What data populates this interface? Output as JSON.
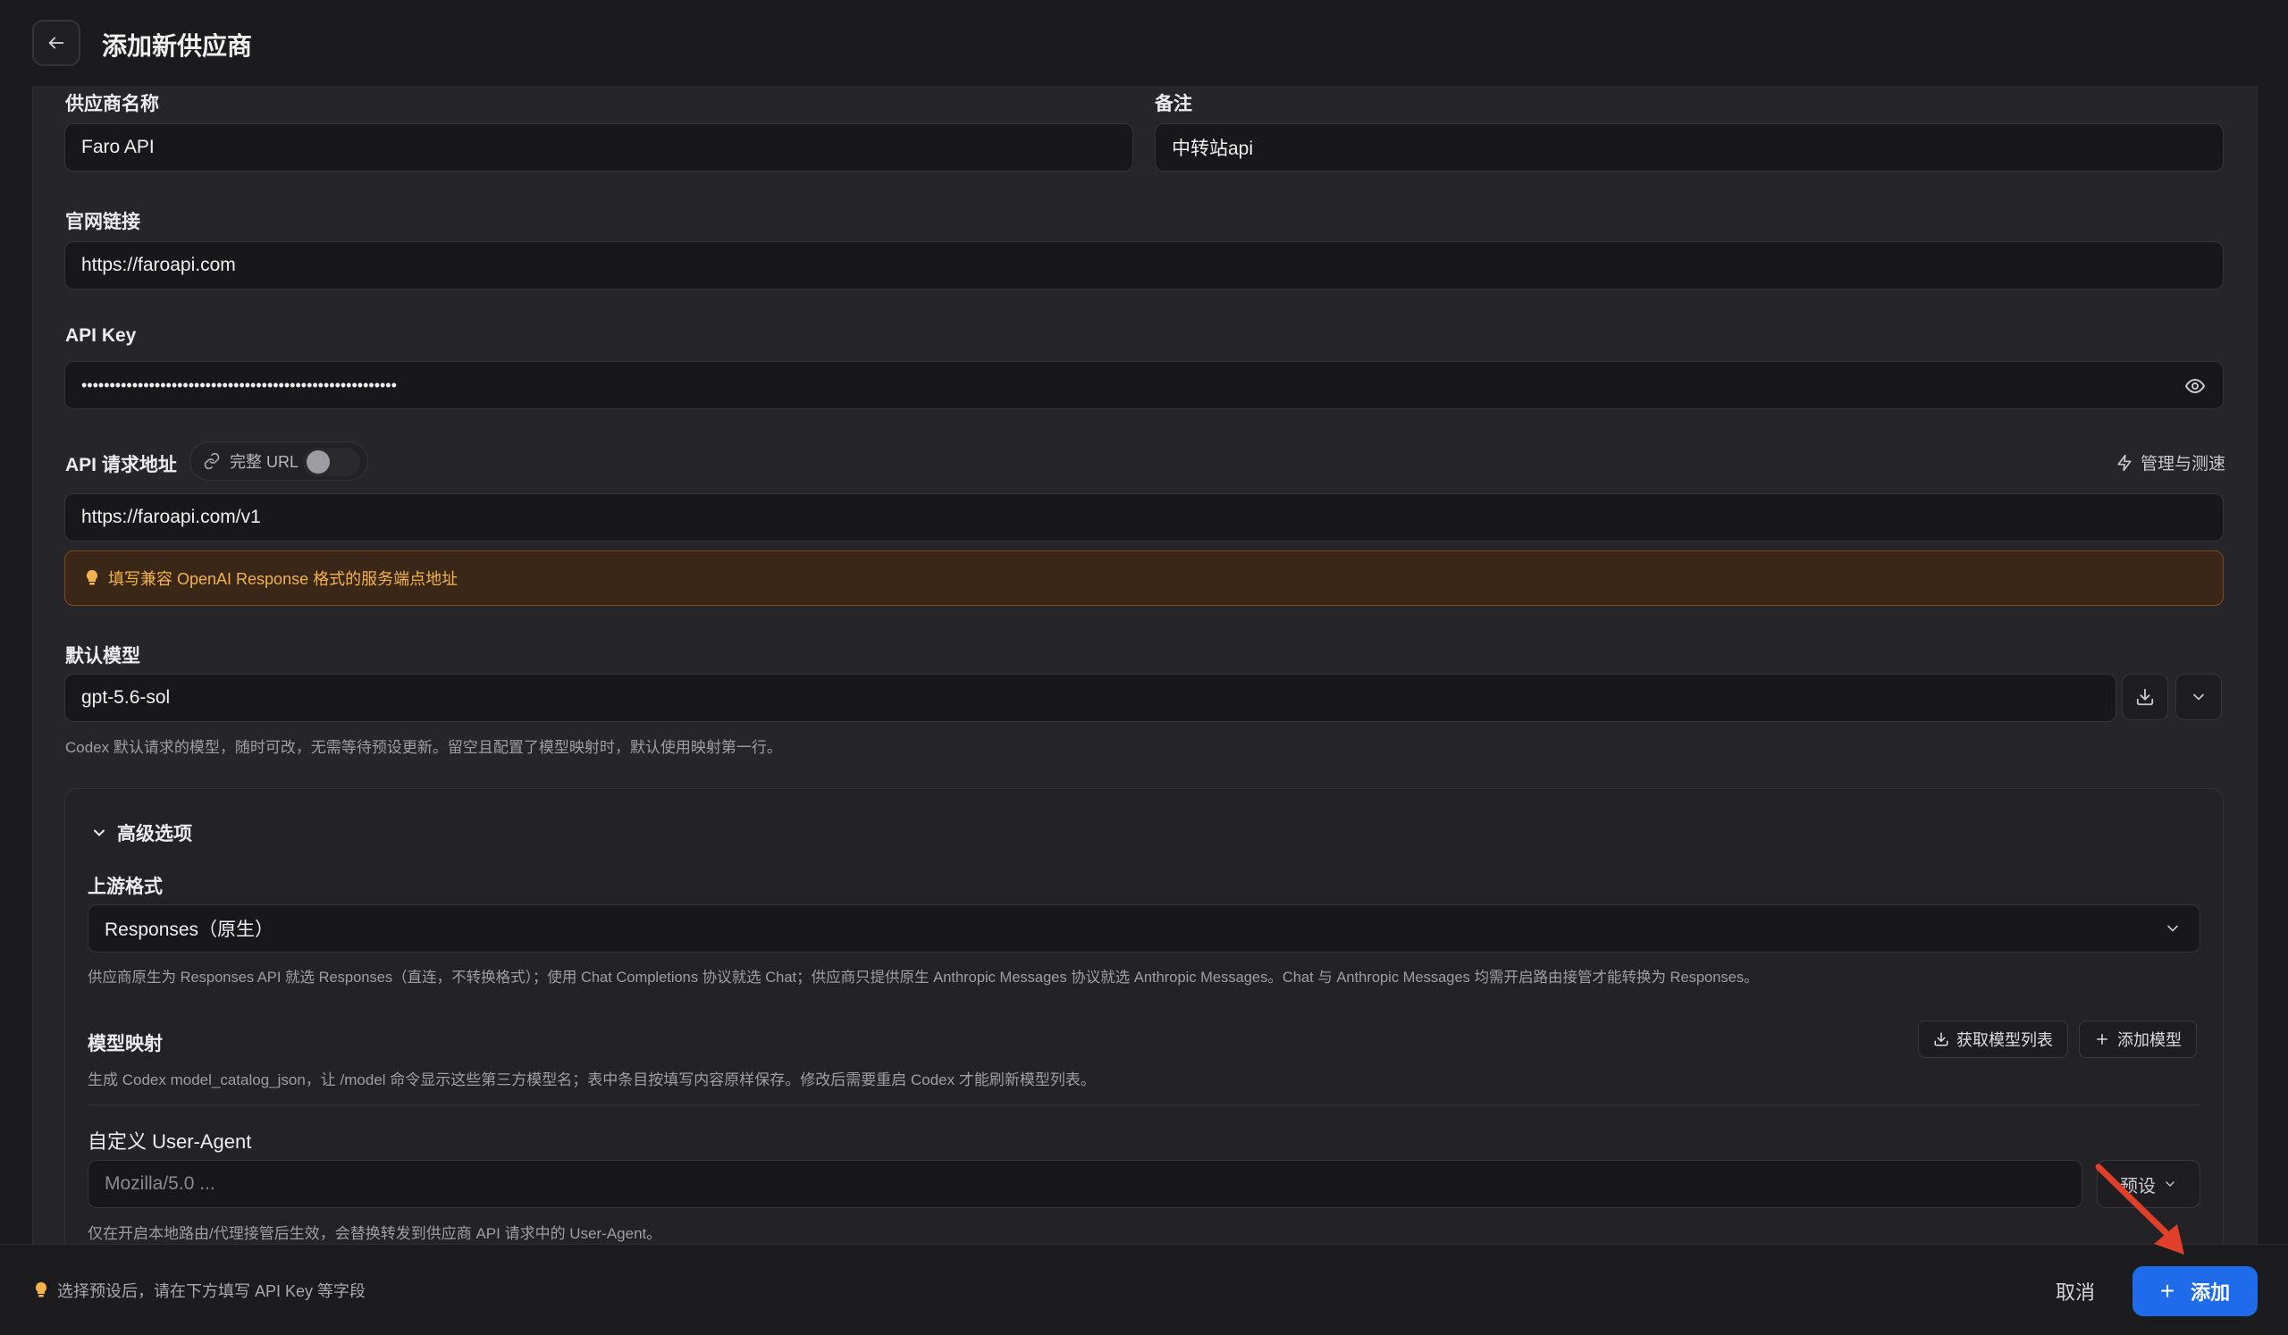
{
  "header": {
    "title": "添加新供应商"
  },
  "form": {
    "provider_name": {
      "label": "供应商名称",
      "value": "Faro API"
    },
    "notes": {
      "label": "备注",
      "value": "中转站api"
    },
    "website": {
      "label": "官网链接",
      "value": "https://faroapi.com"
    },
    "api_key": {
      "label": "API Key",
      "value": "••••••••••••••••••••••••••••••••••••••••••••••••••••••••"
    },
    "endpoint": {
      "label": "API 请求地址",
      "full_url_label": "完整 URL",
      "full_url_enabled": false,
      "manage_label": "管理与测速",
      "value": "https://faroapi.com/v1",
      "warning": "填写兼容 OpenAI Response 格式的服务端点地址"
    },
    "default_model": {
      "label": "默认模型",
      "value": "gpt-5.6-sol",
      "hint": "Codex 默认请求的模型，随时可改，无需等待预设更新。留空且配置了模型映射时，默认使用映射第一行。"
    }
  },
  "advanced": {
    "toggle_label": "高级选项",
    "expanded": true,
    "upstream_format": {
      "label": "上游格式",
      "value": "Responses（原生）",
      "hint": "供应商原生为 Responses API 就选 Responses（直连，不转换格式）；使用 Chat Completions 协议就选 Chat；供应商只提供原生 Anthropic Messages 协议就选 Anthropic Messages。Chat 与 Anthropic Messages 均需开启路由接管才能转换为 Responses。"
    },
    "model_mapping": {
      "label": "模型映射",
      "fetch_label": "获取模型列表",
      "add_label": "添加模型",
      "hint": "生成 Codex model_catalog_json，让 /model 命令显示这些第三方模型名；表中条目按填写内容原样保存。修改后需要重启 Codex 才能刷新模型列表。"
    },
    "user_agent": {
      "label": "自定义 User-Agent",
      "placeholder": "Mozilla/5.0 ...",
      "preset_label": "预设",
      "hint": "仅在开启本地路由/代理接管后生效，会替换转发到供应商 API 请求中的 User-Agent。"
    }
  },
  "footer": {
    "hint": "选择预设后，请在下方填写 API Key 等字段",
    "cancel_label": "取消",
    "add_label": "添加"
  },
  "colors": {
    "background": "#1b1b1d",
    "panel": "#26262a",
    "accent": "#1f6bea",
    "warning_text": "#f4b34a",
    "annotation_arrow": "#e0402a"
  }
}
